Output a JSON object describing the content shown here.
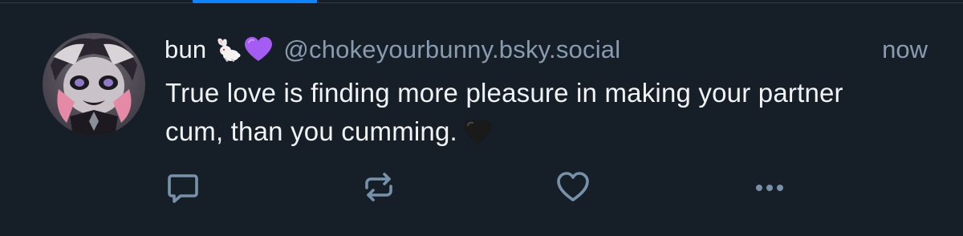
{
  "post": {
    "author": {
      "display_name": "bun",
      "name_emojis": [
        "rabbit-icon",
        "purple-heart-icon"
      ],
      "handle": "@chokeyourbunny.bsky.social"
    },
    "timestamp": "now",
    "text": "True love is finding more pleasure in making your partner cum, than you cumming.",
    "text_trailing_emoji": "black-heart-icon"
  },
  "actions": [
    {
      "name": "reply-button",
      "icon": "reply-icon"
    },
    {
      "name": "repost-button",
      "icon": "repost-icon"
    },
    {
      "name": "like-button",
      "icon": "heart-outline-icon"
    },
    {
      "name": "more-options-button",
      "icon": "ellipsis-icon"
    }
  ],
  "colors": {
    "background": "#161e27",
    "primary_text": "#f1f3f5",
    "secondary_text": "#8a9bb0",
    "icon": "#7891ab",
    "tab_indicator": "#1083fe",
    "divider": "#2e3a48"
  }
}
